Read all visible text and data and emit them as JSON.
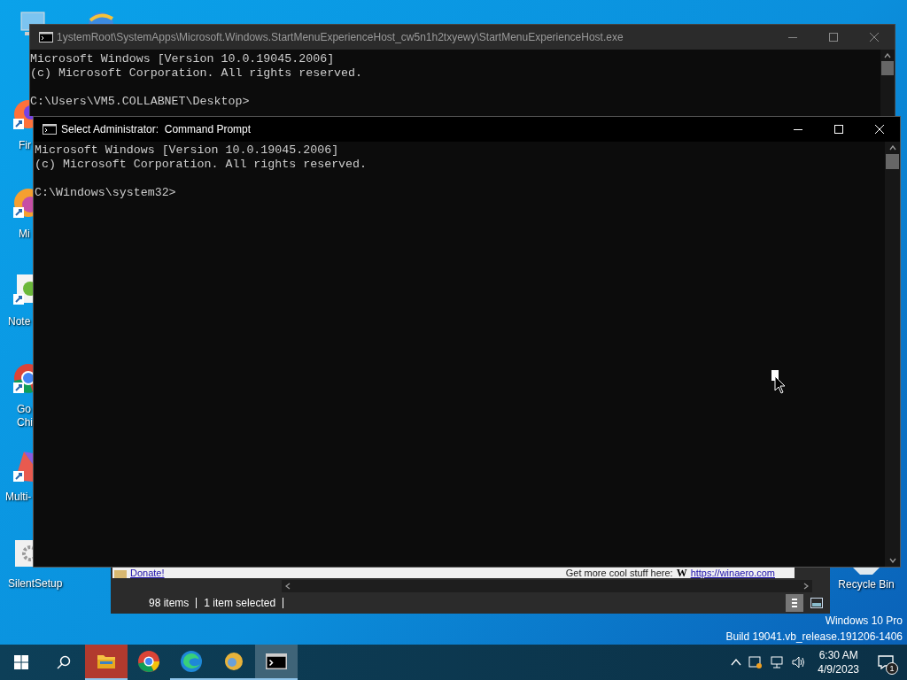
{
  "desktop_icons": [
    {
      "kind": "pc"
    },
    {
      "kind": "ie"
    },
    {
      "label": "Fir",
      "kind": "firefox"
    },
    {
      "label": "Mi",
      "kind": "edge"
    },
    {
      "label": "Note",
      "kind": "notepad"
    },
    {
      "label": "Go\nChi",
      "kind": "chrome"
    },
    {
      "label": "Multi-",
      "kind": "multi"
    },
    {
      "label": "SilentSetup",
      "kind": "gear"
    }
  ],
  "recycle_bin": {
    "label": "Recycle Bin"
  },
  "background_console": {
    "title": "1ystemRoot\\SystemApps\\Microsoft.Windows.StartMenuExperienceHost_cw5n1h2txyewy\\StartMenuExperienceHost.exe",
    "banner": [
      "Microsoft Windows [Version 10.0.19045.2006]",
      "(c) Microsoft Corporation. All rights reserved."
    ],
    "prompt": "C:\\Users\\VM5.COLLABNET\\Desktop>"
  },
  "explorer": {
    "donate_link": "Donate!",
    "promo_text": "Get more cool stuff here:",
    "promo_logo": "W",
    "promo_link": "https://winaero.com",
    "status": [
      "98 items",
      "1 item selected"
    ]
  },
  "front_console": {
    "title": "Select Administrator:  Command Prompt",
    "banner": [
      "Microsoft Windows [Version 10.0.19045.2006]",
      "(c) Microsoft Corporation. All rights reserved."
    ],
    "prompt": "C:\\Windows\\system32>"
  },
  "watermark": [
    "Windows 10 Pro",
    "Build 19041.vb_release.191206-1406"
  ],
  "taskbar": {
    "apps": [
      {
        "kind": "explorer",
        "attention": true,
        "running": true,
        "selected": false
      },
      {
        "kind": "chrome",
        "attention": false,
        "running": false,
        "selected": false
      },
      {
        "kind": "edge",
        "attention": false,
        "running": true,
        "selected": false
      },
      {
        "kind": "winaero",
        "attention": false,
        "running": true,
        "selected": false
      },
      {
        "kind": "cmd",
        "attention": false,
        "running": true,
        "selected": true
      }
    ],
    "time": "6:30 AM",
    "date": "4/9/2023",
    "notification_count": "1"
  }
}
